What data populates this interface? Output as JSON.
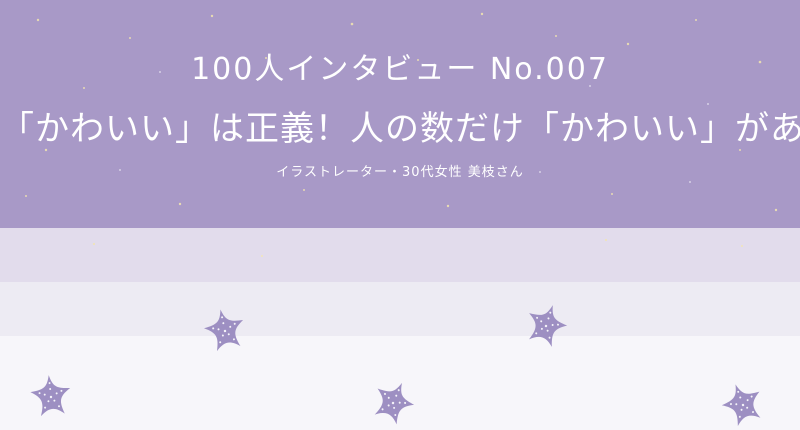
{
  "title": {
    "line1": "100人インタビュー No.007",
    "line2": "「かわいい」は正義！人の数だけ「かわいい」がある"
  },
  "subtitle": "イラストレーター・30代女性 美枝さん",
  "colors": {
    "banner": "#a899c7",
    "band_light": "#e2dcec",
    "band_lighter": "#edebf3",
    "background": "#f7f6fa",
    "starfish": "#9d8fc2",
    "sparkle": "#f3e6b0"
  },
  "decorations": {
    "icon": "starfish-icon"
  }
}
